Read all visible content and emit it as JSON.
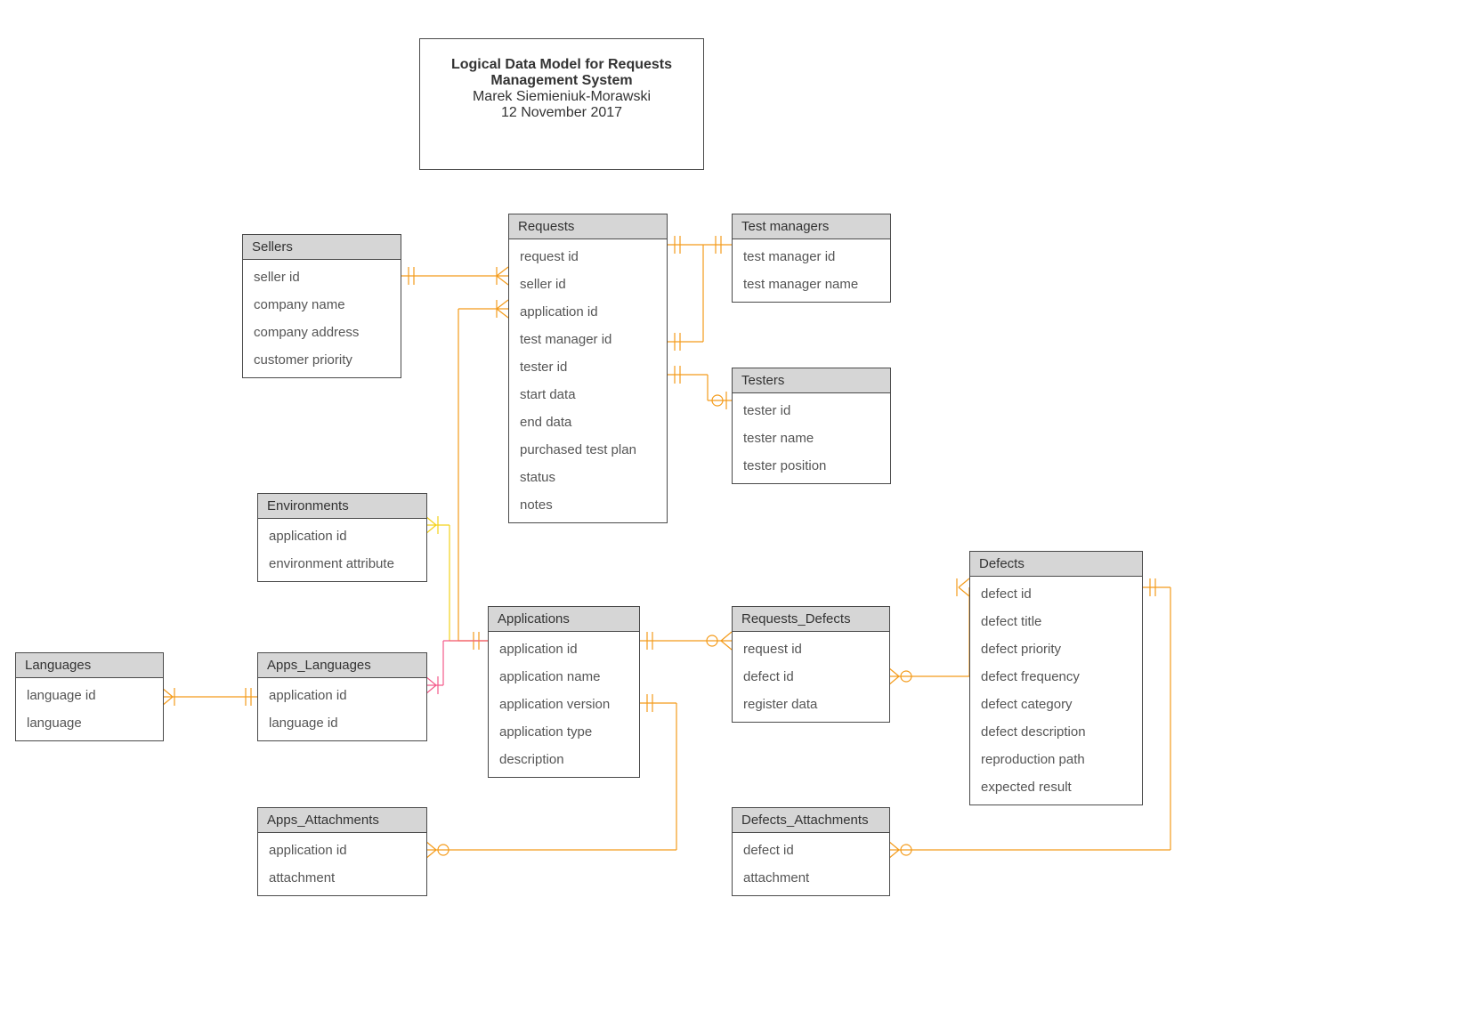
{
  "title": {
    "line1": "Logical Data Model for Requests",
    "line2": "Management System",
    "author": "Marek Siemieniuk-Morawski",
    "date": "12 November 2017"
  },
  "entities": {
    "sellers": {
      "name": "Sellers",
      "attrs": [
        "seller id",
        "company name",
        "company address",
        "customer priority"
      ]
    },
    "requests": {
      "name": "Requests",
      "attrs": [
        "request id",
        "seller id",
        "application id",
        "test manager id",
        "tester id",
        "start data",
        "end data",
        "purchased test plan",
        "status",
        "notes"
      ]
    },
    "test_managers": {
      "name": "Test managers",
      "attrs": [
        "test manager id",
        "test manager name"
      ]
    },
    "testers": {
      "name": "Testers",
      "attrs": [
        "tester id",
        "tester name",
        "tester position"
      ]
    },
    "environments": {
      "name": "Environments",
      "attrs": [
        "application id",
        "environment attribute"
      ]
    },
    "languages": {
      "name": "Languages",
      "attrs": [
        "language id",
        "language"
      ]
    },
    "apps_languages": {
      "name": "Apps_Languages",
      "attrs": [
        "application id",
        "language id"
      ]
    },
    "applications": {
      "name": "Applications",
      "attrs": [
        "application id",
        "application name",
        "application version",
        "application type",
        "description"
      ]
    },
    "requests_defects": {
      "name": "Requests_Defects",
      "attrs": [
        "request id",
        "defect id",
        "register data"
      ]
    },
    "defects": {
      "name": "Defects",
      "attrs": [
        "defect  id",
        "defect title",
        "defect priority",
        "defect frequency",
        "defect category",
        "defect description",
        "reproduction path",
        "expected result"
      ]
    },
    "apps_attachments": {
      "name": "Apps_Attachments",
      "attrs": [
        "application id",
        "attachment"
      ]
    },
    "defects_attachments": {
      "name": "Defects_Attachments",
      "attrs": [
        "defect id",
        "attachment"
      ]
    }
  },
  "colors": {
    "orange": "#f49b1a",
    "yellow": "#f4d21a",
    "pink": "#f45a8a"
  }
}
